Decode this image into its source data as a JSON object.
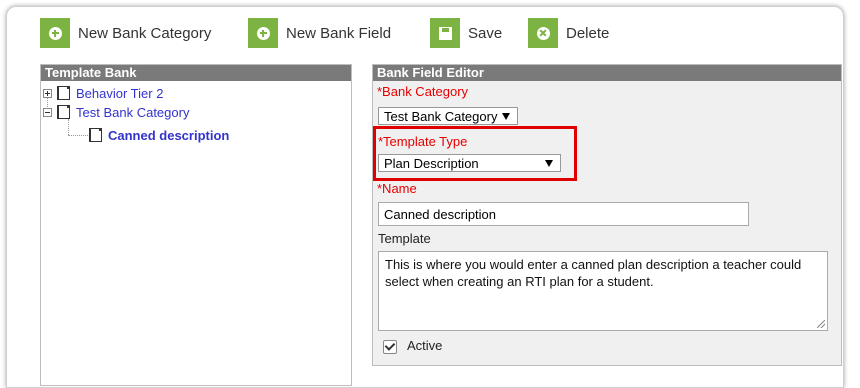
{
  "toolbar": {
    "new_category": "New Bank Category",
    "new_field": "New Bank Field",
    "save": "Save",
    "delete": "Delete"
  },
  "template_bank": {
    "title": "Template Bank",
    "items": [
      {
        "label": "Behavior Tier 2"
      },
      {
        "label": "Test Bank Category"
      },
      {
        "label": "Canned description"
      }
    ]
  },
  "editor": {
    "title": "Bank Field Editor",
    "bank_category_label": "*Bank Category",
    "bank_category_value": "Test Bank Category",
    "template_type_label": "*Template Type",
    "template_type_value": "Plan Description",
    "name_label": "*Name",
    "name_value": "Canned description",
    "template_label": "Template",
    "template_value": "This is where you would enter a canned plan description a teacher could select when creating an RTI plan for a student.",
    "active_label": "Active",
    "active_checked": true
  },
  "colors": {
    "accent_green": "#7cb342",
    "required_red": "#e60000",
    "link_blue": "#3333cc",
    "header_gray": "#7a7a7a"
  }
}
